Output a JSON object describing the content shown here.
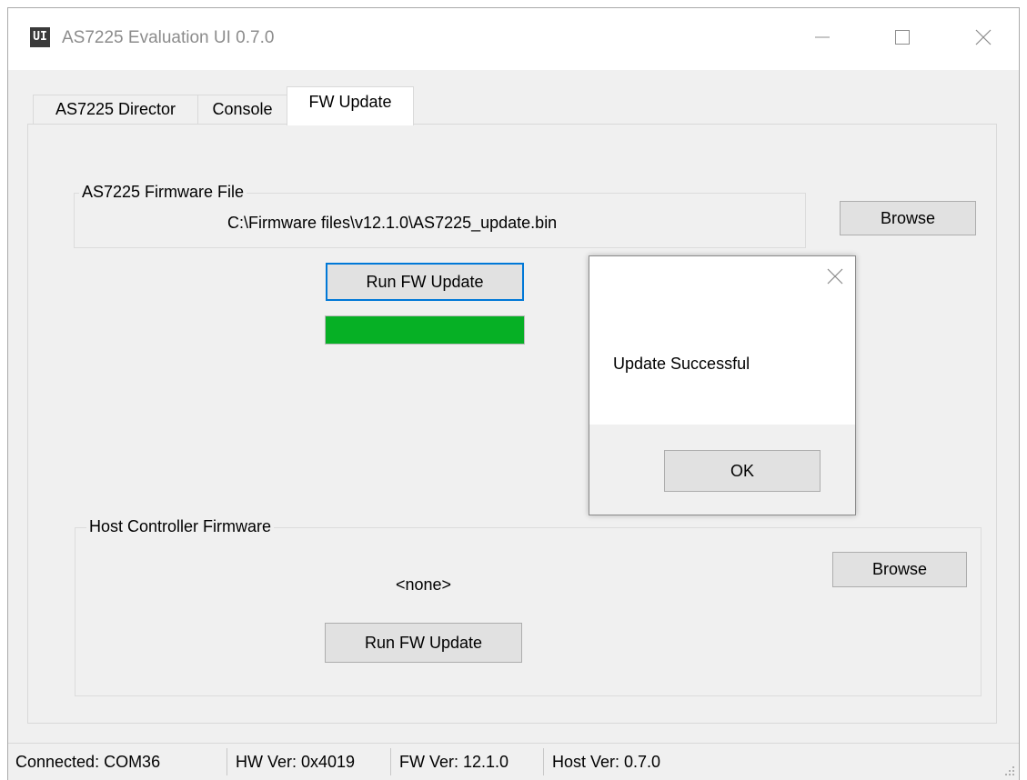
{
  "window": {
    "title": "AS7225 Evaluation UI 0.7.0",
    "icon_label": "UI",
    "controls": [
      "minimize",
      "maximize",
      "close"
    ]
  },
  "tabs": [
    {
      "label": "AS7225 Director"
    },
    {
      "label": "Console"
    },
    {
      "label": "FW Update",
      "active": true
    }
  ],
  "fw_update": {
    "as7225_group": {
      "label": "AS7225 Firmware File",
      "file_path": "C:\\Firmware files\\v12.1.0\\AS7225_update.bin",
      "browse_label": "Browse",
      "run_label": "Run FW Update",
      "progress": 1.0,
      "progress_color": "#06b025"
    },
    "host_group": {
      "label": "Host Controller Firmware",
      "file_path": "<none>",
      "browse_label": "Browse",
      "run_label": "Run FW Update"
    }
  },
  "dialog": {
    "message": "Update Successful",
    "ok_label": "OK"
  },
  "status_bar": {
    "connected": "Connected: COM36",
    "hw_ver": "HW Ver: 0x4019",
    "fw_ver": "FW Ver: 12.1.0",
    "host_ver": "Host Ver: 0.7.0"
  },
  "colors": {
    "focus_accent": "#0078d7",
    "progress_green": "#06b025"
  }
}
